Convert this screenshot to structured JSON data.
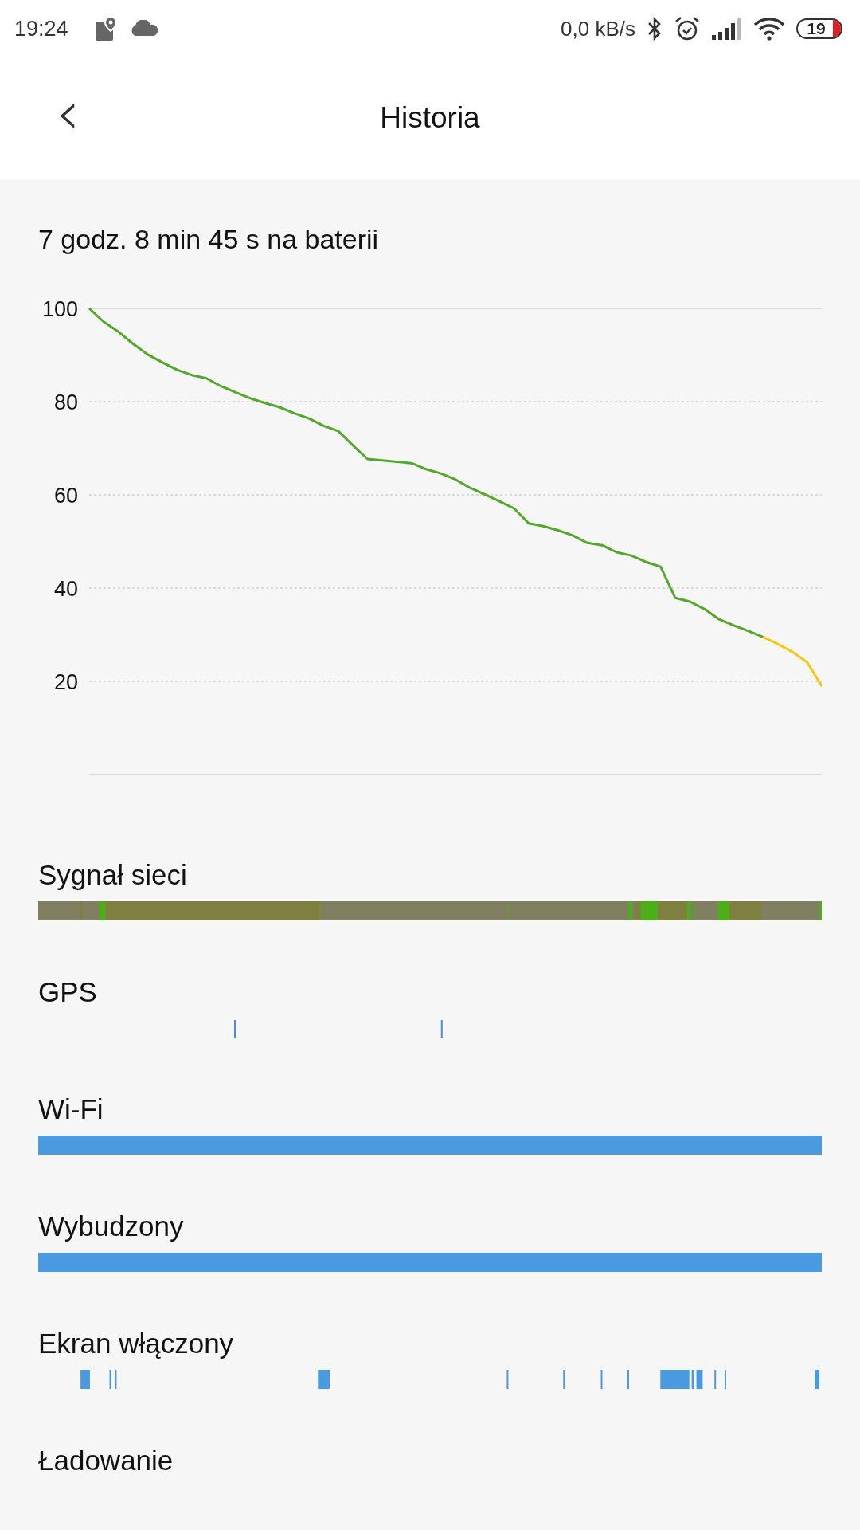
{
  "status_bar": {
    "time": "19:24",
    "network_speed": "0,0 kB/s",
    "battery": "19"
  },
  "header": {
    "back": "‹",
    "title": "Historia"
  },
  "summary": "7 godz. 8 min 45 s na baterii",
  "chart_data": {
    "type": "line",
    "ylim": [
      0,
      100
    ],
    "yticks": [
      20,
      40,
      60,
      80,
      100
    ],
    "grid": true,
    "series": [
      {
        "color": "#52a829",
        "values": [
          100,
          97.1,
          95.0,
          92.4,
          90.1,
          88.4,
          86.8,
          85.7,
          85.0,
          83.3,
          82.0,
          80.7,
          79.7,
          78.8,
          77.5,
          76.4,
          74.8,
          73.7,
          70.6,
          67.7,
          67.4,
          67.1,
          66.8,
          65.5,
          64.6,
          63.3,
          61.5,
          60.1,
          58.6,
          57.1,
          53.9,
          53.3,
          52.4,
          51.3,
          49.7,
          49.2,
          47.7,
          47.0,
          45.6,
          44.6,
          37.9,
          37.1,
          35.5,
          33.3,
          32.0,
          30.8,
          29.5,
          null,
          null,
          null,
          null
        ]
      },
      {
        "color": "#f2c811",
        "values": [
          null,
          null,
          null,
          null,
          null,
          null,
          null,
          null,
          null,
          null,
          null,
          null,
          null,
          null,
          null,
          null,
          null,
          null,
          null,
          null,
          null,
          null,
          null,
          null,
          null,
          null,
          null,
          null,
          null,
          null,
          null,
          null,
          null,
          null,
          null,
          null,
          null,
          null,
          null,
          null,
          null,
          null,
          null,
          null,
          null,
          null,
          29.5,
          28.0,
          26.3,
          24.1,
          19.0
        ]
      }
    ]
  },
  "sections": [
    {
      "title": "Sygnał sieci",
      "kind": "signal"
    },
    {
      "title": "GPS",
      "kind": "gps"
    },
    {
      "title": "Wi-Fi",
      "kind": "wifi"
    },
    {
      "title": "Wybudzony",
      "kind": "awake"
    },
    {
      "title": "Ekran włączony",
      "kind": "screen"
    },
    {
      "title": "Ładowanie",
      "kind": "charging"
    }
  ]
}
